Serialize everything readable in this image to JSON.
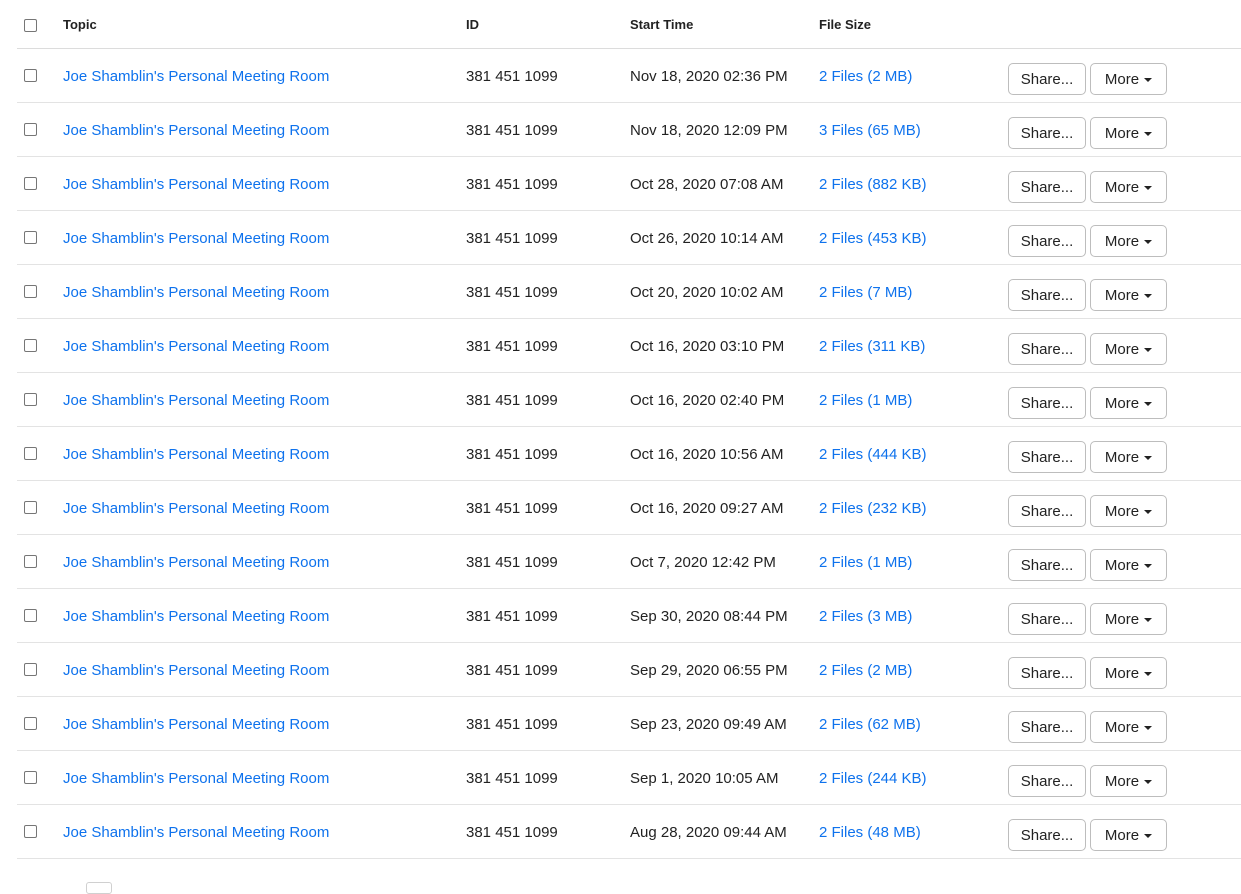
{
  "table": {
    "headers": {
      "topic": "Topic",
      "id": "ID",
      "start_time": "Start Time",
      "file_size": "File Size"
    },
    "share_label": "Share...",
    "more_label": "More",
    "rows": [
      {
        "topic": "Joe Shamblin's Personal Meeting Room",
        "id": "381 451 1099",
        "start_time": "Nov 18, 2020 02:36 PM",
        "file_size": "2 Files (2 MB)"
      },
      {
        "topic": "Joe Shamblin's Personal Meeting Room",
        "id": "381 451 1099",
        "start_time": "Nov 18, 2020 12:09 PM",
        "file_size": "3 Files (65 MB)"
      },
      {
        "topic": "Joe Shamblin's Personal Meeting Room",
        "id": "381 451 1099",
        "start_time": "Oct 28, 2020 07:08 AM",
        "file_size": "2 Files (882 KB)"
      },
      {
        "topic": "Joe Shamblin's Personal Meeting Room",
        "id": "381 451 1099",
        "start_time": "Oct 26, 2020 10:14 AM",
        "file_size": "2 Files (453 KB)"
      },
      {
        "topic": "Joe Shamblin's Personal Meeting Room",
        "id": "381 451 1099",
        "start_time": "Oct 20, 2020 10:02 AM",
        "file_size": "2 Files (7 MB)"
      },
      {
        "topic": "Joe Shamblin's Personal Meeting Room",
        "id": "381 451 1099",
        "start_time": "Oct 16, 2020 03:10 PM",
        "file_size": "2 Files (311 KB)"
      },
      {
        "topic": "Joe Shamblin's Personal Meeting Room",
        "id": "381 451 1099",
        "start_time": "Oct 16, 2020 02:40 PM",
        "file_size": "2 Files (1 MB)"
      },
      {
        "topic": "Joe Shamblin's Personal Meeting Room",
        "id": "381 451 1099",
        "start_time": "Oct 16, 2020 10:56 AM",
        "file_size": "2 Files (444 KB)"
      },
      {
        "topic": "Joe Shamblin's Personal Meeting Room",
        "id": "381 451 1099",
        "start_time": "Oct 16, 2020 09:27 AM",
        "file_size": "2 Files (232 KB)"
      },
      {
        "topic": "Joe Shamblin's Personal Meeting Room",
        "id": "381 451 1099",
        "start_time": "Oct 7, 2020 12:42 PM",
        "file_size": "2 Files (1 MB)"
      },
      {
        "topic": "Joe Shamblin's Personal Meeting Room",
        "id": "381 451 1099",
        "start_time": "Sep 30, 2020 08:44 PM",
        "file_size": "2 Files (3 MB)"
      },
      {
        "topic": "Joe Shamblin's Personal Meeting Room",
        "id": "381 451 1099",
        "start_time": "Sep 29, 2020 06:55 PM",
        "file_size": "2 Files (2 MB)"
      },
      {
        "topic": "Joe Shamblin's Personal Meeting Room",
        "id": "381 451 1099",
        "start_time": "Sep 23, 2020 09:49 AM",
        "file_size": "2 Files (62 MB)"
      },
      {
        "topic": "Joe Shamblin's Personal Meeting Room",
        "id": "381 451 1099",
        "start_time": "Sep 1, 2020 10:05 AM",
        "file_size": "2 Files (244 KB)"
      },
      {
        "topic": "Joe Shamblin's Personal Meeting Room",
        "id": "381 451 1099",
        "start_time": "Aug 28, 2020 09:44 AM",
        "file_size": "2 Files (48 MB)"
      }
    ]
  },
  "icons": {
    "more_caret": "caret-down-icon"
  },
  "colors": {
    "link": "#0e72ed",
    "text": "#222222",
    "border": "#e3e3e3"
  }
}
